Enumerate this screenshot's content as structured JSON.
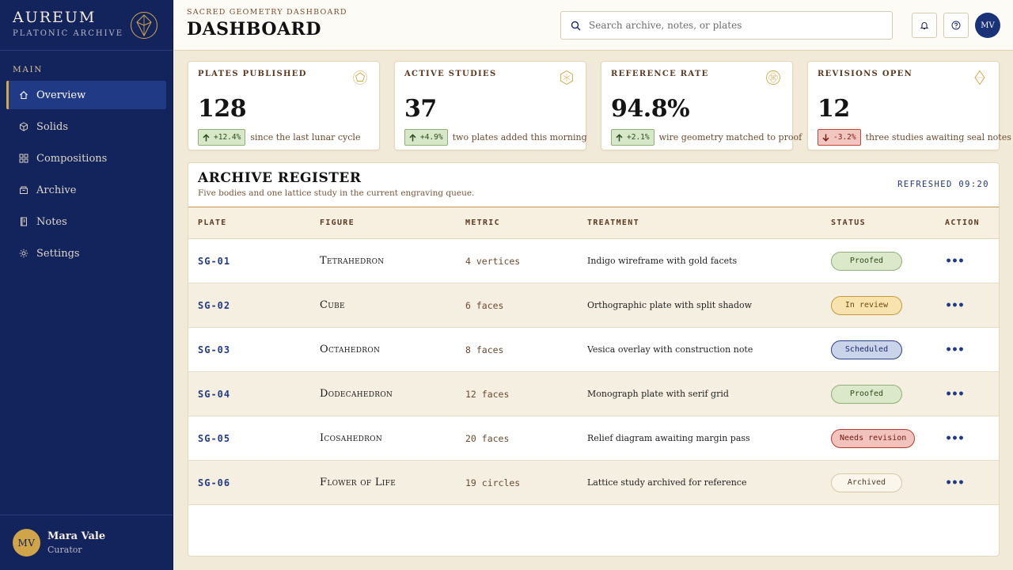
{
  "sidebar": {
    "brand": "AUREUM",
    "brand_sub": "PLATONIC ARCHIVE",
    "section": "MAIN",
    "items": [
      {
        "label": "Overview",
        "icon": "home-icon",
        "active": true
      },
      {
        "label": "Solids",
        "icon": "cube-icon"
      },
      {
        "label": "Compositions",
        "icon": "grid-icon"
      },
      {
        "label": "Archive",
        "icon": "archive-box-icon"
      },
      {
        "label": "Notes",
        "icon": "notebook-icon"
      },
      {
        "label": "Settings",
        "icon": "gear-icon"
      }
    ],
    "user": {
      "initials": "MV",
      "name": "Mara Vale",
      "role": "Curator"
    }
  },
  "header": {
    "eyebrow": "SACRED GEOMETRY DASHBOARD",
    "title": "DASHBOARD",
    "search_placeholder": "Search archive, notes, or plates",
    "avatar_initials": "MV"
  },
  "kpis": [
    {
      "label": "PLATES PUBLISHED",
      "value": "128",
      "delta": "+12.4%",
      "direction": "up",
      "note": "since the last lunar cycle",
      "icon": "pentagon-icon"
    },
    {
      "label": "ACTIVE STUDIES",
      "value": "37",
      "delta": "+4.9%",
      "direction": "up",
      "note": "two plates added this morning",
      "icon": "hexagon-star-icon"
    },
    {
      "label": "REFERENCE RATE",
      "value": "94.8%",
      "delta": "+2.1%",
      "direction": "up",
      "note": "wire geometry matched to proof",
      "icon": "seed-of-life-icon"
    },
    {
      "label": "REVISIONS OPEN",
      "value": "12",
      "delta": "-3.2%",
      "direction": "down",
      "note": "three studies awaiting seal notes",
      "icon": "diamond-icon"
    }
  ],
  "register": {
    "title": "ARCHIVE REGISTER",
    "subtitle": "Five bodies and one lattice study in the current engraving queue.",
    "refreshed": "REFRESHED 09:20",
    "columns": [
      "PLATE",
      "FIGURE",
      "METRIC",
      "TREATMENT",
      "STATUS",
      "ACTION"
    ],
    "rows": [
      {
        "plate": "SG-01",
        "figure": "Tetrahedron",
        "metric": "4 vertices",
        "treatment": "Indigo wireframe with gold facets",
        "status": "Proofed",
        "status_kind": "proofed"
      },
      {
        "plate": "SG-02",
        "figure": "Cube",
        "metric": "6 faces",
        "treatment": "Orthographic plate with split shadow",
        "status": "In review",
        "status_kind": "review"
      },
      {
        "plate": "SG-03",
        "figure": "Octahedron",
        "metric": "8 faces",
        "treatment": "Vesica overlay with construction note",
        "status": "Scheduled",
        "status_kind": "sched"
      },
      {
        "plate": "SG-04",
        "figure": "Dodecahedron",
        "metric": "12 faces",
        "treatment": "Monograph plate with serif grid",
        "status": "Proofed",
        "status_kind": "proofed"
      },
      {
        "plate": "SG-05",
        "figure": "Icosahedron",
        "metric": "20 faces",
        "treatment": "Relief diagram awaiting margin pass",
        "status": "Needs revision",
        "status_kind": "revision"
      },
      {
        "plate": "SG-06",
        "figure": "Flower of Life",
        "metric": "19 circles",
        "treatment": "Lattice study archived for reference",
        "status": "Archived",
        "status_kind": "archived"
      }
    ],
    "action_glyph": "•••"
  },
  "colors": {
    "navy": "#13235c",
    "gold": "#d3a84a",
    "parchment": "#f2ead9"
  }
}
